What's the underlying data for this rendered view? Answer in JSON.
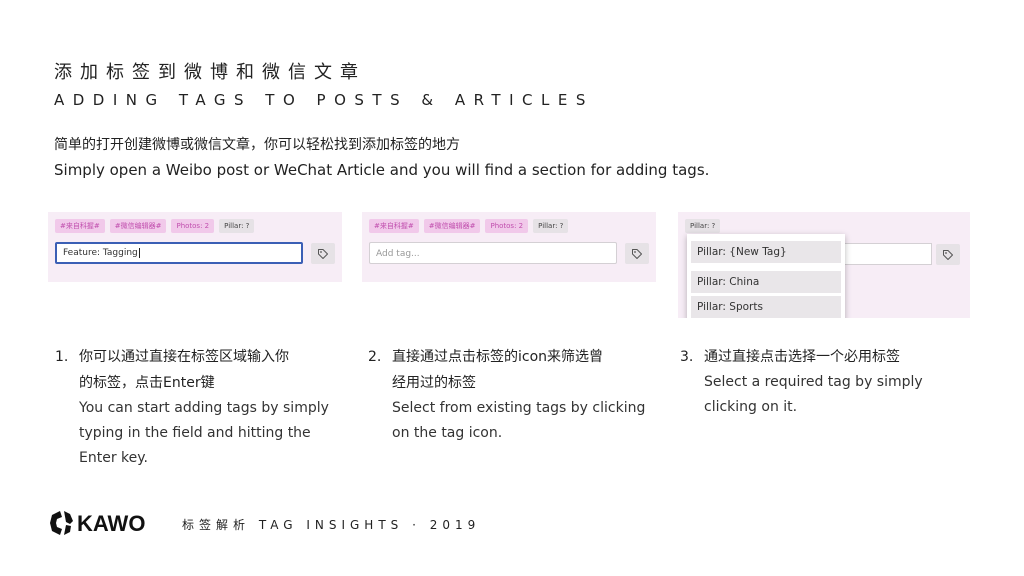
{
  "header": {
    "title_zh": "添加标签到微博和微信文章",
    "title_en": "ADDING TAGS TO POSTS & ARTICLES",
    "intro_zh": "简单的打开创建微博或微信文章，你可以轻松找到添加标签的地方",
    "intro_en": "Simply open a Weibo post or WeChat Article and you will find a section for adding tags."
  },
  "panels": {
    "chips": [
      {
        "label": "#来自科握#",
        "style": "pink"
      },
      {
        "label": "#微信编辑器#",
        "style": "pink"
      },
      {
        "label": "Photos: 2",
        "style": "pink"
      },
      {
        "label": "Pillar: ?",
        "style": "gray"
      }
    ],
    "panel1_input_value": "Feature: Tagging",
    "panel2_input_placeholder": "Add tag...",
    "panel3_chip": "Pillar: ?",
    "dropdown_items": [
      "Pillar: {New Tag}",
      "Pillar: China",
      "Pillar: Sports"
    ],
    "tag_icon": "tag-icon"
  },
  "steps": [
    {
      "number": "1.",
      "zh_line1": "你可以通过直接在标签区域输入你",
      "zh_line2": "的标签，点击Enter键",
      "en_line1": "You can start adding tags by simply",
      "en_line2": "typing in the field and hitting the",
      "en_line3": "Enter key."
    },
    {
      "number": "2.",
      "zh_line1": "直接通过点击标签的icon来筛选曾",
      "zh_line2": "经用过的标签",
      "en_line1": "Select from existing tags by clicking",
      "en_line2": "on the tag icon."
    },
    {
      "number": "3.",
      "zh_line1": "通过直接点击选择一个必用标签",
      "en_line1": "Select a required tag by simply",
      "en_line2": "clicking on it."
    }
  ],
  "footer": {
    "logo": "KAWO",
    "text": "标签解析 TAG INSIGHTS · 2019"
  },
  "colors": {
    "panel_bg": "#f7edf6",
    "chip_pink_bg": "#f1c9ea",
    "chip_pink_text": "#c14fae",
    "focus_border": "#3b5fb5"
  }
}
